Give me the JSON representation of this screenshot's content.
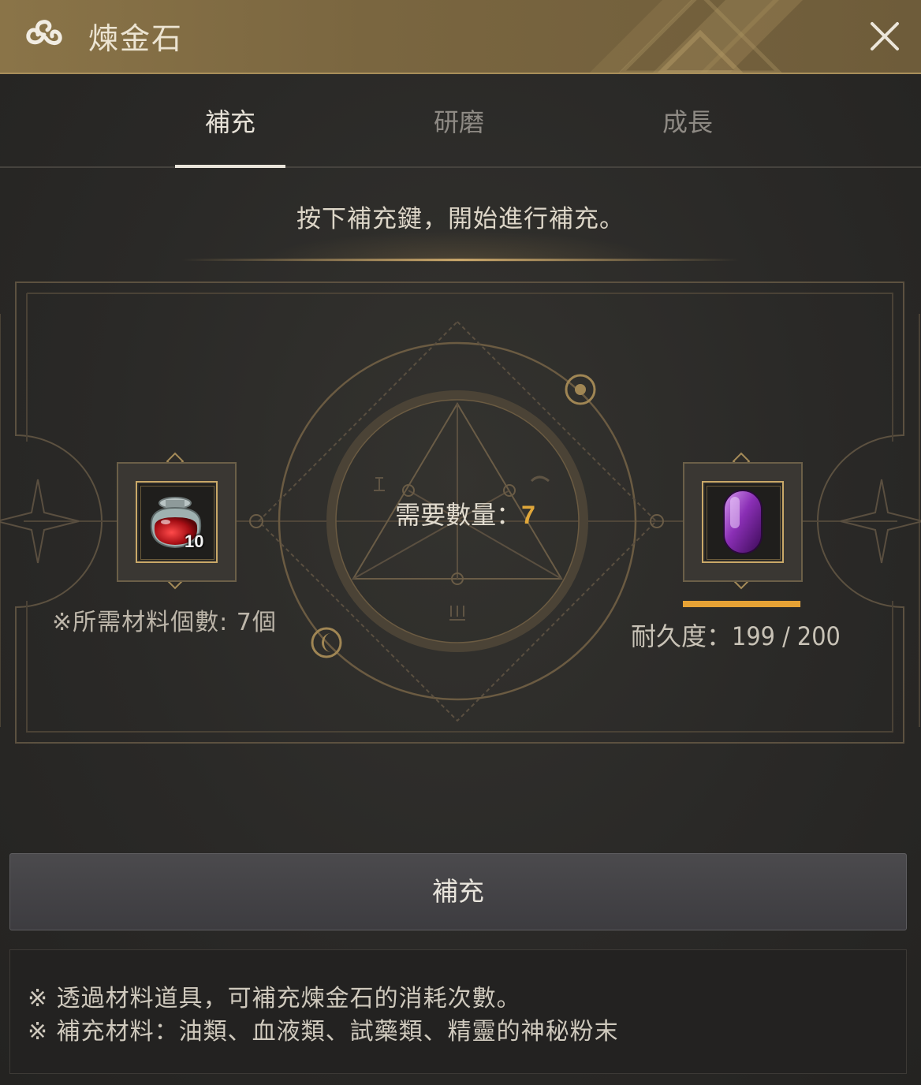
{
  "window": {
    "title": "煉金石"
  },
  "tabs": [
    {
      "label": "補充",
      "active": true
    },
    {
      "label": "研磨",
      "active": false
    },
    {
      "label": "成長",
      "active": false
    }
  ],
  "instruction": "按下補充鍵，開始進行補充。",
  "material": {
    "icon": "red-potion-jar-icon",
    "stack_count": "10",
    "required_label": "※所需材料個數: 7個"
  },
  "center": {
    "need_label": "需要數量：",
    "need_value": "7"
  },
  "alchemy_stone": {
    "icon": "purple-alchemy-stone-icon",
    "durability_label": "耐久度：199 / 200",
    "durability_fraction": 0.995,
    "durability_color": "#e6a235"
  },
  "refill_button": {
    "label": "補充"
  },
  "notes": [
    "※ 透過材料道具，可補充煉金石的消耗次數。",
    "※ 補充材料：油類、血液類、試藥類、精靈的神秘粉末"
  ],
  "colors": {
    "accent_gold": "#c9a868",
    "title_bar": "#7a6640"
  }
}
